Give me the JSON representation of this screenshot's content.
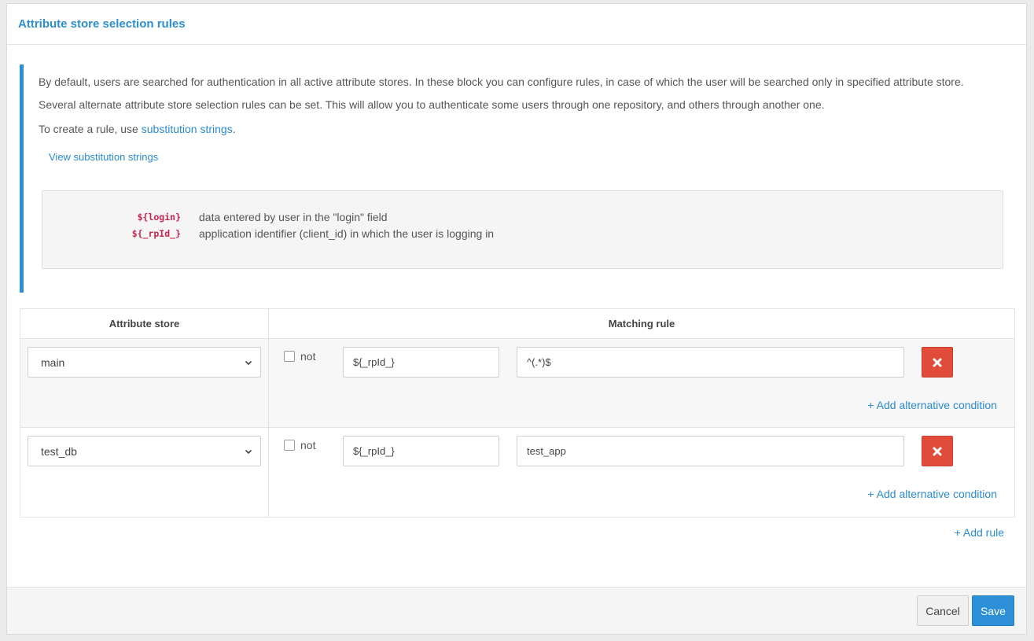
{
  "panel": {
    "title": "Attribute store selection rules"
  },
  "info": {
    "paragraph1": "By default, users are searched for authentication in all active attribute stores. In these block you can configure rules, in case of which the user will be searched only in specified attribute store.",
    "paragraph2": "Several alternate attribute store selection rules can be set. This will allow you to authenticate some users through one repository, and others through another one.",
    "paragraph3_prefix": "To create a rule, use ",
    "paragraph3_link": "substitution strings",
    "paragraph3_suffix": ".",
    "view_substitutions_link": "View substitution strings",
    "substitutions": [
      {
        "code": "${login}",
        "description": "data entered by user in the \"login\" field"
      },
      {
        "code": "${_rpId_}",
        "description": "application identifier (client_id) in which the user is logging in"
      }
    ]
  },
  "table": {
    "headers": {
      "attribute_store": "Attribute store",
      "matching_rule": "Matching rule"
    },
    "rows": [
      {
        "store": "main",
        "not_label": "not",
        "not_checked": false,
        "field": "${_rpId_}",
        "pattern": "^(.*)$",
        "add_alternative": "+ Add alternative condition"
      },
      {
        "store": "test_db",
        "not_label": "not",
        "not_checked": false,
        "field": "${_rpId_}",
        "pattern": "test_app",
        "add_alternative": "+ Add alternative condition"
      }
    ],
    "add_rule": "+ Add rule"
  },
  "footer": {
    "cancel_label": "Cancel",
    "save_label": "Save"
  },
  "colors": {
    "accent": "#2d8fd5",
    "danger": "#e04b3a",
    "code": "#c7254e"
  }
}
